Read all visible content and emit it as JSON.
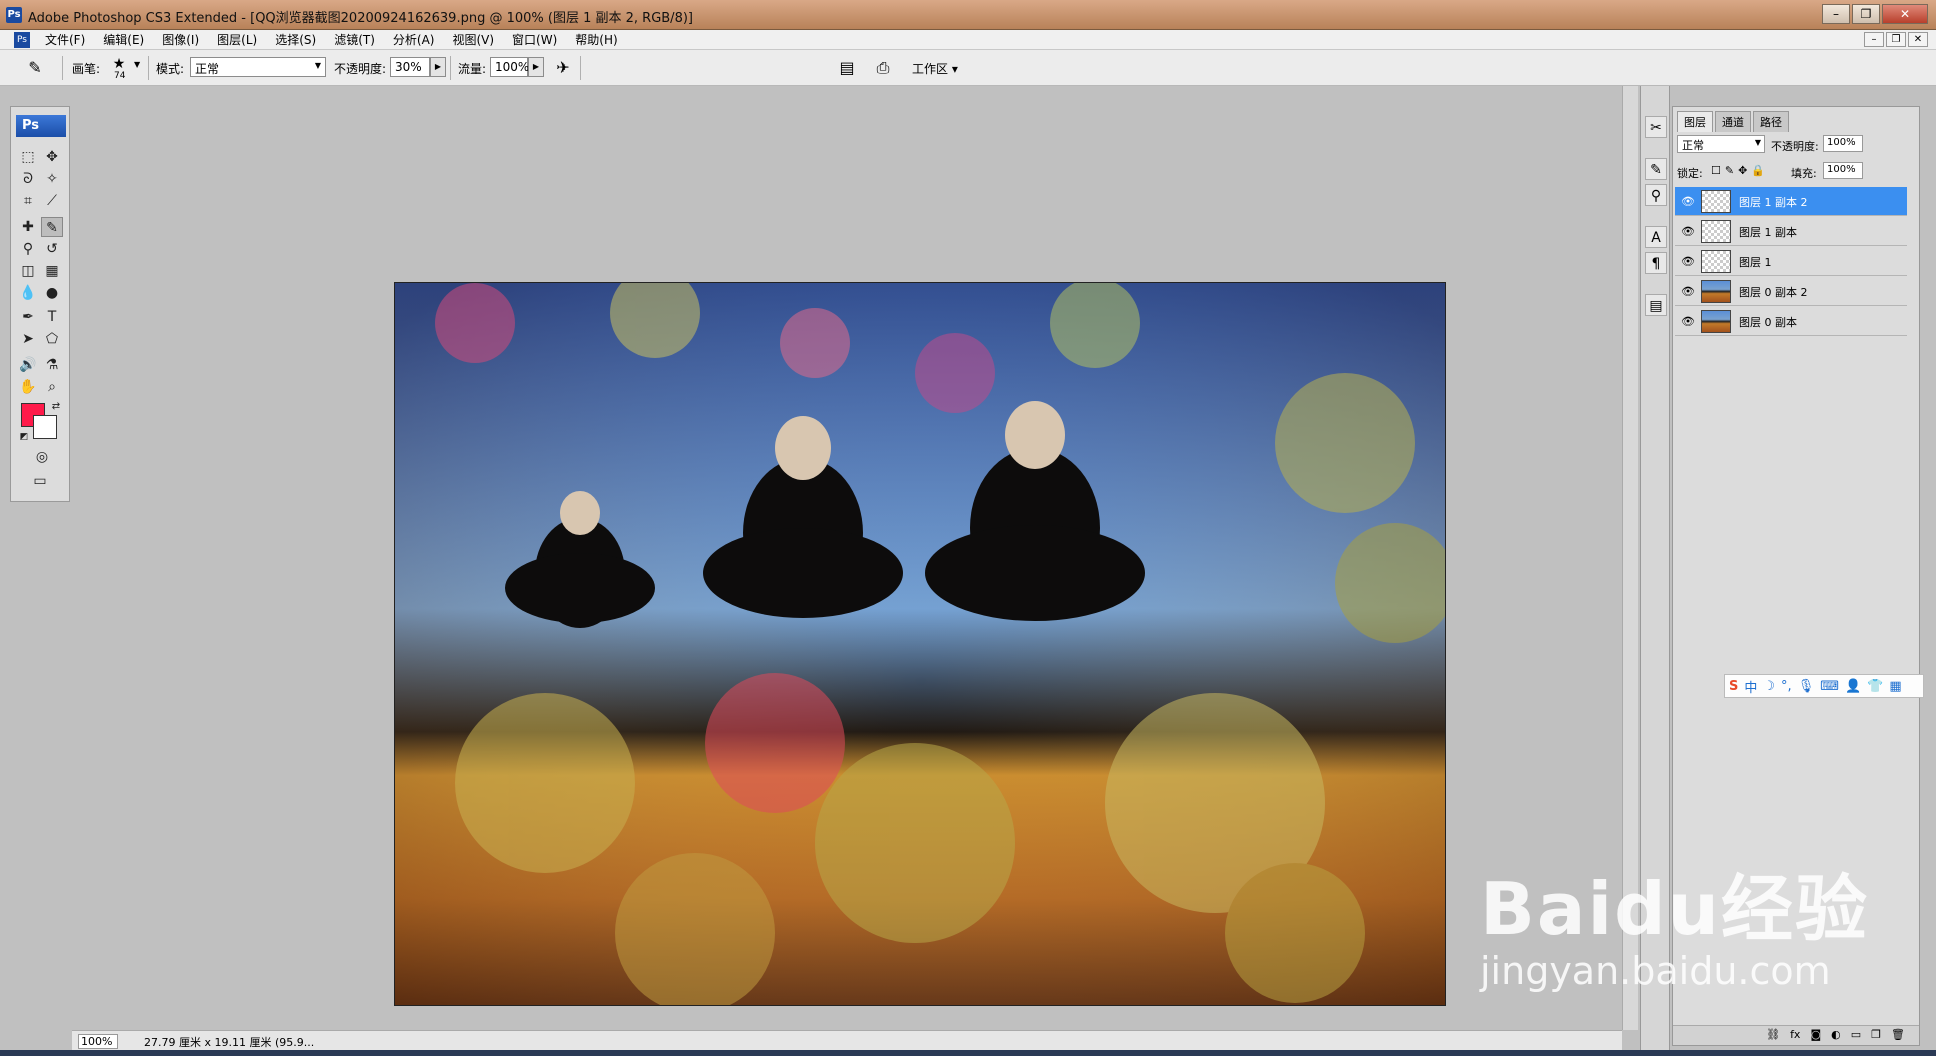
{
  "window": {
    "title": "Adobe Photoshop CS3 Extended - [QQ浏览器截图20200924162639.png @ 100% (图层 1 副本 2, RGB/8)]",
    "app_badge": "Ps"
  },
  "menu": [
    "文件(F)",
    "编辑(E)",
    "图像(I)",
    "图层(L)",
    "选择(S)",
    "滤镜(T)",
    "分析(A)",
    "视图(V)",
    "窗口(W)",
    "帮助(H)"
  ],
  "options": {
    "brush_label": "画笔:",
    "brush_size": "74",
    "mode_label": "模式:",
    "mode_value": "正常",
    "opacity_label": "不透明度:",
    "opacity_value": "30%",
    "flow_label": "流量:",
    "flow_value": "100%",
    "workspace_label": "工作区"
  },
  "toolbox": {
    "logo": "Ps",
    "foreground_color": "#ff1a4a",
    "background_color": "#ffffff"
  },
  "layers_panel": {
    "tabs": [
      "图层",
      "通道",
      "路径"
    ],
    "blend_mode": "正常",
    "opacity_label": "不透明度:",
    "opacity_value": "100%",
    "lock_label": "锁定:",
    "fill_label": "填充:",
    "fill_value": "100%",
    "layers": [
      {
        "name": "图层 1 副本 2",
        "selected": true,
        "thumb": "transparent"
      },
      {
        "name": "图层 1 副本",
        "selected": false,
        "thumb": "transparent"
      },
      {
        "name": "图层 1",
        "selected": false,
        "thumb": "transparent"
      },
      {
        "name": "图层 0 副本 2",
        "selected": false,
        "thumb": "photo"
      },
      {
        "name": "图层 0 副本",
        "selected": false,
        "thumb": "photo"
      }
    ]
  },
  "status": {
    "zoom": "100%",
    "doc_info": "27.79 厘米 x 19.11 厘米 (95.9..."
  },
  "ime": {
    "brand": "S",
    "lang": "中"
  },
  "watermark": {
    "main": "Baidu经验",
    "sub": "jingyan.baidu.com"
  }
}
